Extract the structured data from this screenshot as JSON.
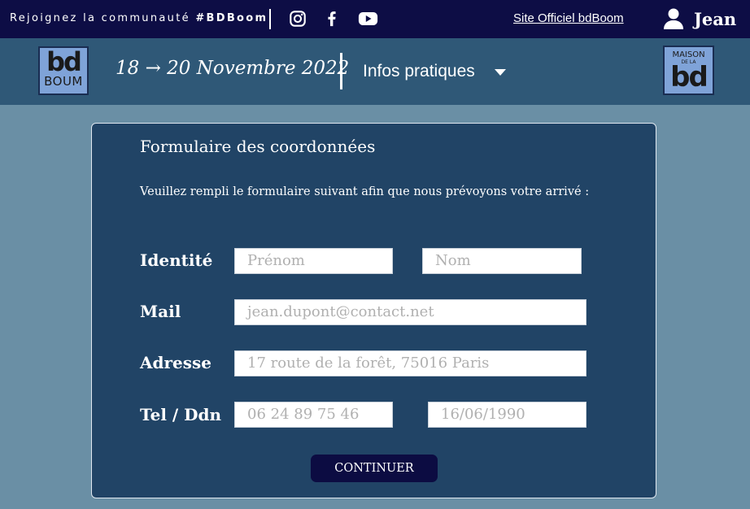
{
  "topbar": {
    "slogan_prefix": "Rejoignez la communauté ",
    "slogan_tag": "#BDBoom",
    "social": [
      "instagram-icon",
      "facebook-icon",
      "youtube-icon"
    ],
    "site_link": "Site Officiel bdBoom",
    "username": "Jean"
  },
  "header": {
    "logo_left": {
      "big": "bd",
      "small": "BOUM"
    },
    "dates": "18 → 20 Novembre 2022",
    "menu_label": "Infos pratiques",
    "logo_right": {
      "maison": "MAISON",
      "dela": "DE LA",
      "big": "bd"
    }
  },
  "form": {
    "title": "Formulaire des coordonnées",
    "intro": "Veuillez rempli le formulaire suivant afin que nous prévoyons votre arrivé :",
    "identity": {
      "label": "Identité",
      "firstname_placeholder": "Prénom",
      "lastname_placeholder": "Nom"
    },
    "mail": {
      "label": "Mail",
      "placeholder": "jean.dupont@contact.net"
    },
    "address": {
      "label": "Adresse",
      "placeholder": "17 route de la forêt, 75016 Paris"
    },
    "phone_dob": {
      "label": "Tel / Ddn",
      "phone_placeholder": "06 24 89 75 46",
      "dob_placeholder": "16/06/1990"
    },
    "submit_label": "CONTINUER"
  },
  "colors": {
    "topbar": "#0d0d45",
    "header": "#2f5877",
    "page_background": "#6a8fa5",
    "card": "#214466",
    "button": "#0c0c42",
    "logo": "#7fa3d8"
  }
}
